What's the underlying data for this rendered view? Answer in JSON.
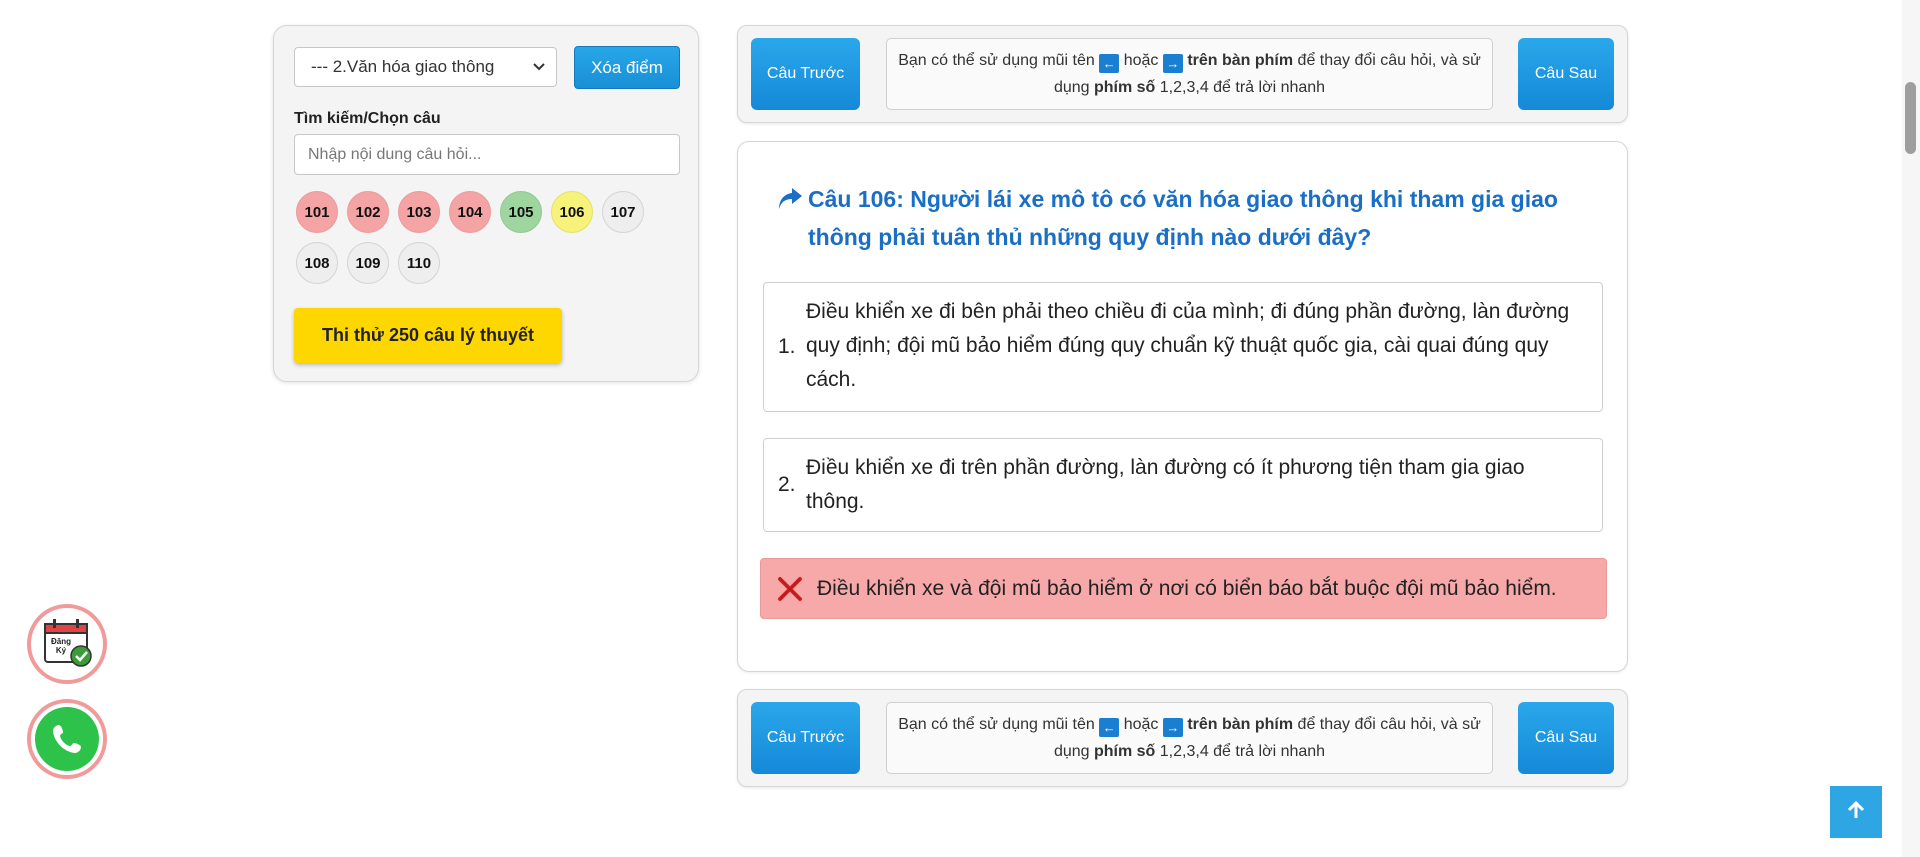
{
  "sidebar": {
    "topic_select_value": "--- 2.Văn hóa giao thông",
    "reset_label": "Xóa điểm",
    "search_label": "Tìm kiếm/Chọn câu",
    "search_placeholder": "Nhập nội dung câu hỏi...",
    "question_numbers": [
      {
        "label": "101",
        "status": "wrong"
      },
      {
        "label": "102",
        "status": "wrong"
      },
      {
        "label": "103",
        "status": "wrong"
      },
      {
        "label": "104",
        "status": "wrong"
      },
      {
        "label": "105",
        "status": "correct"
      },
      {
        "label": "106",
        "status": "current"
      },
      {
        "label": "107",
        "status": "unanswered"
      },
      {
        "label": "108",
        "status": "unanswered"
      },
      {
        "label": "109",
        "status": "unanswered"
      },
      {
        "label": "110",
        "status": "unanswered"
      }
    ],
    "exam_button_label": "Thi thử 250 câu lý thuyết"
  },
  "nav": {
    "prev_label": "Câu Trước",
    "next_label": "Câu Sau",
    "hint_1": "Bạn có thể sử dụng mũi tên",
    "hint_or": "hoặc",
    "hint_keyboard": "trên bàn phím",
    "hint_2": "để thay đổi câu hỏi, và sử dụng",
    "hint_numkeys": "phím số",
    "hint_3": "1,2,3,4 để trả lời nhanh",
    "left_key": "←",
    "right_key": "→"
  },
  "question": {
    "title": "Câu 106: Người lái xe mô tô có văn hóa giao thông khi tham gia giao thông phải tuân thủ những quy định nào dưới đây?",
    "answers": [
      {
        "num": "1.",
        "text": "Điều khiển xe đi bên phải theo chiều đi của mình; đi đúng phần đường, làn đường quy định; đội mũ bảo hiểm đúng quy chuẩn kỹ thuật quốc gia, cài quai đúng quy cách."
      },
      {
        "num": "2.",
        "text": "Điều khiển xe đi trên phần đường, làn đường có ít phương tiện tham gia giao thông."
      },
      {
        "num": "",
        "text": "Điều khiển xe và đội mũ bảo hiểm ở nơi có biển báo bắt buộc đội mũ bảo hiểm.",
        "state": "wrong"
      }
    ]
  },
  "floating": {
    "register_text_1": "Đăng",
    "register_text_2": "Ký"
  },
  "colors": {
    "primary": "#1a8fd6",
    "title_blue": "#1a6fc4",
    "wrong_bg": "#f7a8a8",
    "correct_bg": "#9fd59f",
    "current_bg": "#f7f27a",
    "exam_yellow": "#ffd700"
  },
  "icons": [
    "share-arrow-icon",
    "close-x-icon",
    "calendar-check-icon",
    "phone-icon",
    "arrow-up-icon",
    "chevron-down-icon"
  ]
}
